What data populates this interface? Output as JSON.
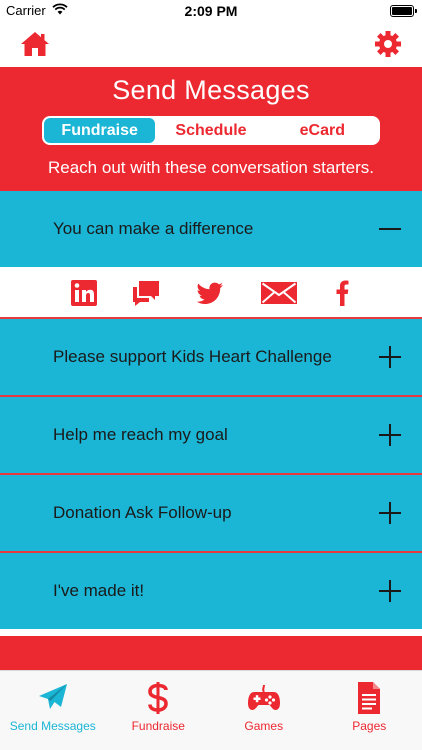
{
  "status_bar": {
    "carrier": "Carrier",
    "time": "2:09 PM"
  },
  "nav": {
    "home_icon": "home-icon",
    "settings_icon": "gear-icon"
  },
  "header": {
    "title": "Send Messages",
    "tabs": [
      {
        "label": "Fundraise",
        "active": true
      },
      {
        "label": "Schedule",
        "active": false
      },
      {
        "label": "eCard",
        "active": false
      }
    ],
    "subtitle": "Reach out with these conversation starters."
  },
  "messages": [
    {
      "label": "You can make a difference",
      "expanded": true
    },
    {
      "label": "Please support Kids Heart Challenge",
      "expanded": false
    },
    {
      "label": "Help me reach my goal",
      "expanded": false
    },
    {
      "label": "Donation Ask Follow-up",
      "expanded": false
    },
    {
      "label": "I've made it!",
      "expanded": false
    }
  ],
  "share_icons": [
    "linkedin-icon",
    "sms-icon",
    "twitter-icon",
    "email-icon",
    "facebook-icon"
  ],
  "tab_bar": [
    {
      "label": "Send Messages",
      "icon": "paper-plane-icon",
      "active": true
    },
    {
      "label": "Fundraise",
      "icon": "dollar-icon",
      "active": false
    },
    {
      "label": "Games",
      "icon": "gamepad-icon",
      "active": false
    },
    {
      "label": "Pages",
      "icon": "document-icon",
      "active": false
    }
  ],
  "colors": {
    "red": "#ec2830",
    "cyan": "#1bb5d5",
    "white": "#ffffff"
  }
}
